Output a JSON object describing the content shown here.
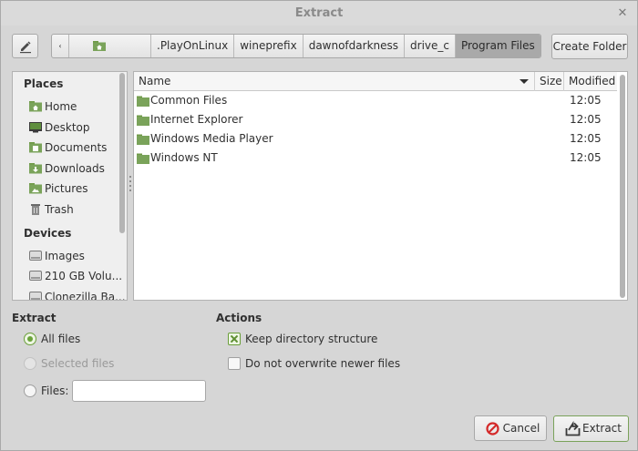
{
  "window": {
    "title": "Extract",
    "close_glyph": "✕"
  },
  "toolbar": {
    "edit_icon": "pencil-icon",
    "create_folder_label": "Create Folder"
  },
  "pathbar": {
    "back_glyph": "‹",
    "home_icon": "home-folder-icon",
    "segments": [
      ".PlayOnLinux",
      "wineprefix",
      "dawnofdarkness",
      "drive_c",
      "Program Files"
    ],
    "active_index": 4
  },
  "places": {
    "places_header": "Places",
    "items": [
      {
        "label": "Home",
        "icon": "home-folder-icon"
      },
      {
        "label": "Desktop",
        "icon": "desktop-icon"
      },
      {
        "label": "Documents",
        "icon": "documents-folder-icon"
      },
      {
        "label": "Downloads",
        "icon": "downloads-folder-icon"
      },
      {
        "label": "Pictures",
        "icon": "pictures-folder-icon"
      },
      {
        "label": "Trash",
        "icon": "trash-icon"
      }
    ],
    "devices_header": "Devices",
    "devices": [
      {
        "label": "Images",
        "icon": "drive-icon"
      },
      {
        "label": "210 GB Volu...",
        "icon": "drive-icon"
      },
      {
        "label": "Clonezilla Ba...",
        "icon": "drive-icon"
      }
    ]
  },
  "file_list": {
    "columns": {
      "name": "Name",
      "size": "Size",
      "modified": "Modified"
    },
    "rows": [
      {
        "name": "Common Files",
        "size": "",
        "modified": "12:05"
      },
      {
        "name": "Internet Explorer",
        "size": "",
        "modified": "12:05"
      },
      {
        "name": "Windows Media Player",
        "size": "",
        "modified": "12:05"
      },
      {
        "name": "Windows NT",
        "size": "",
        "modified": "12:05"
      }
    ]
  },
  "extract_section": {
    "header": "Extract",
    "all_files": "All files",
    "selected_files": "Selected files",
    "files_label": "Files:",
    "files_value": "",
    "selected": "all_files"
  },
  "actions_section": {
    "header": "Actions",
    "keep_structure": "Keep directory structure",
    "keep_structure_checked": true,
    "no_overwrite": "Do not overwrite newer files",
    "no_overwrite_checked": false
  },
  "buttons": {
    "cancel": "Cancel",
    "extract": "Extract"
  },
  "colors": {
    "accent_green": "#6aa33a",
    "folder_green": "#7aa35a",
    "cancel_red": "#d42a2a"
  }
}
